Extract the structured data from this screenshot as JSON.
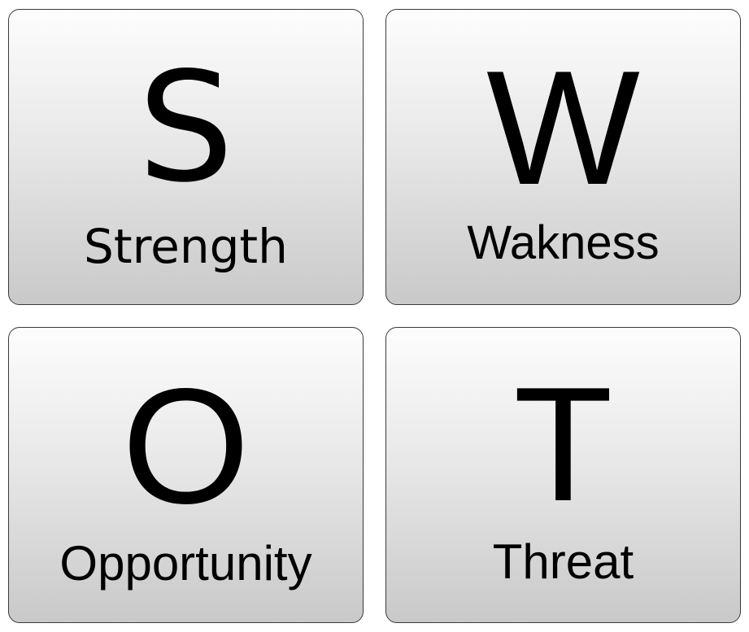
{
  "tiles": [
    {
      "letter": "S",
      "label": "Strength"
    },
    {
      "letter": "W",
      "label": "Wakness"
    },
    {
      "letter": "O",
      "label": "Opportunity"
    },
    {
      "letter": "T",
      "label": "Threat"
    }
  ],
  "colors": {
    "border": "#3a3a3a",
    "gradient_top": "#fdfdfd",
    "gradient_bottom": "#c9c9c9",
    "text": "#000000"
  }
}
